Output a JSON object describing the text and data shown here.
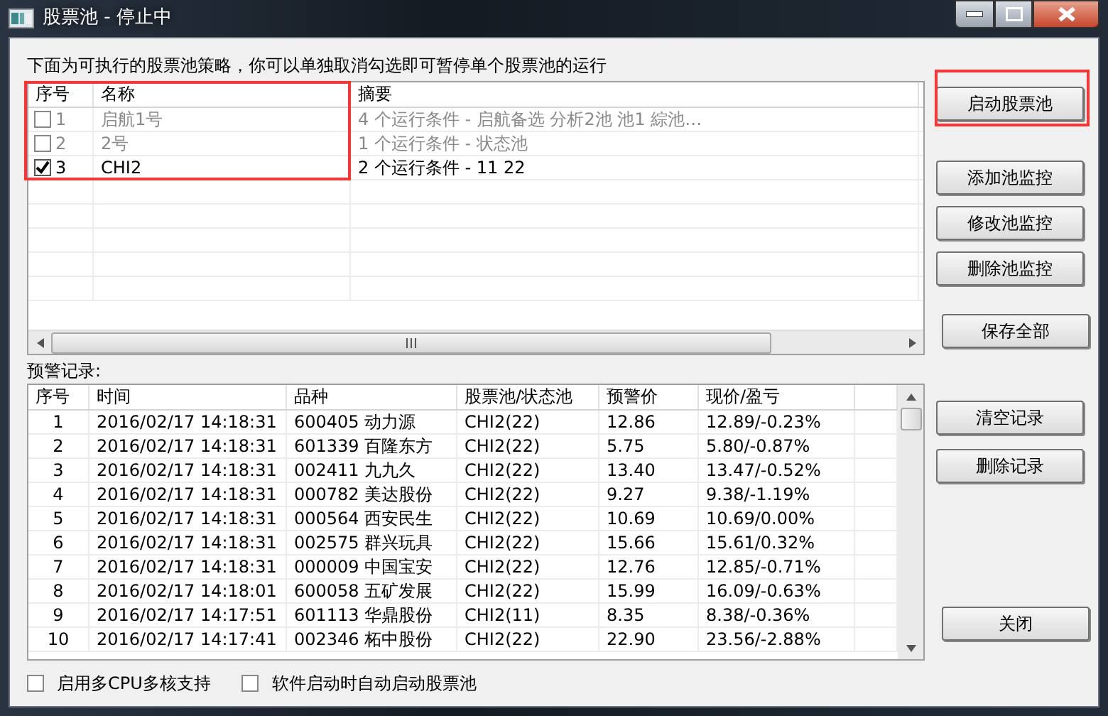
{
  "window": {
    "title": "股票池 - 停止中"
  },
  "instruction": "下面为可执行的股票池策略，你可以单独取消勾选即可暂停单个股票池的运行",
  "pool_list": {
    "columns": [
      "序号",
      "名称",
      "摘要"
    ],
    "rows": [
      {
        "checked": false,
        "index": "1",
        "name": "启航1号",
        "summary": "4 个运行条件 - 启航备选 分析2池 池1 綜池…"
      },
      {
        "checked": false,
        "index": "2",
        "name": "2号",
        "summary": "1 个运行条件 - 状态池"
      },
      {
        "checked": true,
        "index": "3",
        "name": "CHI2",
        "summary": "2 个运行条件 - 11 22"
      }
    ]
  },
  "alerts_label": "预警记录:",
  "alerts_table": {
    "columns": [
      "序号",
      "时间",
      "品种",
      "股票池/状态池",
      "预警价",
      "现价/盈亏"
    ],
    "rows": [
      [
        "1",
        "2016/02/17 14:18:31",
        "600405 动力源",
        "CHI2(22)",
        "12.86",
        "12.89/-0.23%"
      ],
      [
        "2",
        "2016/02/17 14:18:31",
        "601339 百隆东方",
        "CHI2(22)",
        "5.75",
        "5.80/-0.87%"
      ],
      [
        "3",
        "2016/02/17 14:18:31",
        "002411 九九久",
        "CHI2(22)",
        "13.40",
        "13.47/-0.52%"
      ],
      [
        "4",
        "2016/02/17 14:18:31",
        "000782 美达股份",
        "CHI2(22)",
        "9.27",
        "9.38/-1.19%"
      ],
      [
        "5",
        "2016/02/17 14:18:31",
        "000564 西安民生",
        "CHI2(22)",
        "10.69",
        "10.69/0.00%"
      ],
      [
        "6",
        "2016/02/17 14:18:31",
        "002575 群兴玩具",
        "CHI2(22)",
        "15.66",
        "15.61/0.32%"
      ],
      [
        "7",
        "2016/02/17 14:18:31",
        "000009 中国宝安",
        "CHI2(22)",
        "12.76",
        "12.85/-0.71%"
      ],
      [
        "8",
        "2016/02/17 14:18:01",
        "600058 五矿发展",
        "CHI2(22)",
        "15.99",
        "16.09/-0.63%"
      ],
      [
        "9",
        "2016/02/17 14:17:51",
        "601113 华鼎股份",
        "CHI2(11)",
        "8.35",
        "8.38/-0.36%"
      ],
      [
        "10",
        "2016/02/17 14:17:41",
        "002346 柘中股份",
        "CHI2(22)",
        "22.90",
        "23.56/-2.88%"
      ]
    ]
  },
  "buttons": [
    {
      "label": "启动股票池"
    },
    {
      "label": "添加池监控"
    },
    {
      "label": "修改池监控"
    },
    {
      "label": "删除池监控"
    },
    {
      "label": "保存全部"
    },
    {
      "label": "清空记录"
    },
    {
      "label": "删除记录"
    },
    {
      "label": "关闭"
    }
  ],
  "options": [
    {
      "label": "启用多CPU多核支持",
      "checked": false
    },
    {
      "label": "软件启动时自动启动股票池",
      "checked": false
    }
  ]
}
